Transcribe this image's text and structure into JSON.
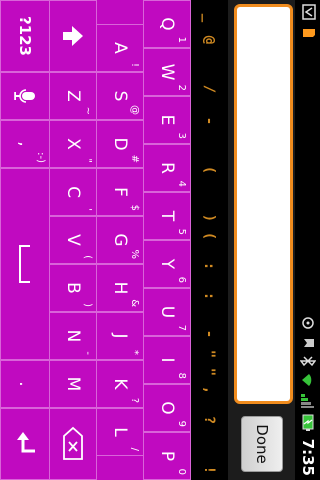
{
  "status_bar": {
    "time": "7:35",
    "icons": [
      "usb-icon",
      "location-icon",
      "notification-icon",
      "bluetooth-icon",
      "battery-icon",
      "signal-icon",
      "wifi-icon",
      "sd-card-icon"
    ]
  },
  "edit_bar": {
    "text_value": "",
    "done_label": "Done"
  },
  "symbol_strip": [
    "_",
    "@",
    "/",
    "-",
    "(",
    ")",
    "(",
    ":",
    ":",
    "-",
    "\"",
    "\"",
    ",",
    "?",
    "!"
  ],
  "keyboard": {
    "color": "#c00ac0",
    "rows": [
      [
        {
          "label": "Q",
          "hint": "1"
        },
        {
          "label": "W",
          "hint": "2"
        },
        {
          "label": "E",
          "hint": "3"
        },
        {
          "label": "R",
          "hint": "4"
        },
        {
          "label": "T",
          "hint": "5"
        },
        {
          "label": "Y",
          "hint": "6"
        },
        {
          "label": "U",
          "hint": "7"
        },
        {
          "label": "I",
          "hint": "8"
        },
        {
          "label": "O",
          "hint": "9"
        },
        {
          "label": "P",
          "hint": "0"
        }
      ],
      [
        {
          "label": "A",
          "hint": "!"
        },
        {
          "label": "S",
          "hint": "@"
        },
        {
          "label": "D",
          "hint": "#"
        },
        {
          "label": "F",
          "hint": "$"
        },
        {
          "label": "G",
          "hint": "%"
        },
        {
          "label": "H",
          "hint": "&"
        },
        {
          "label": "J",
          "hint": "*"
        },
        {
          "label": "K",
          "hint": "?"
        },
        {
          "label": "L",
          "hint": "/"
        }
      ],
      [
        {
          "label": "Z",
          "hint": "~"
        },
        {
          "label": "X",
          "hint": "\""
        },
        {
          "label": "C",
          "hint": "'"
        },
        {
          "label": "V",
          "hint": "("
        },
        {
          "label": "B",
          "hint": ")"
        },
        {
          "label": "N",
          "hint": "-"
        },
        {
          "label": "M",
          "hint": ""
        }
      ]
    ],
    "shift_icon": "shift-arrow-icon",
    "backspace_icon": "backspace-icon",
    "symbols_label": "?123",
    "mic_icon": "microphone-icon",
    "comma_label": ",",
    "smiley_label": ":-)",
    "space_icon": "space-bar-icon",
    "period_label": ".",
    "enter_icon": "enter-arrow-icon"
  }
}
